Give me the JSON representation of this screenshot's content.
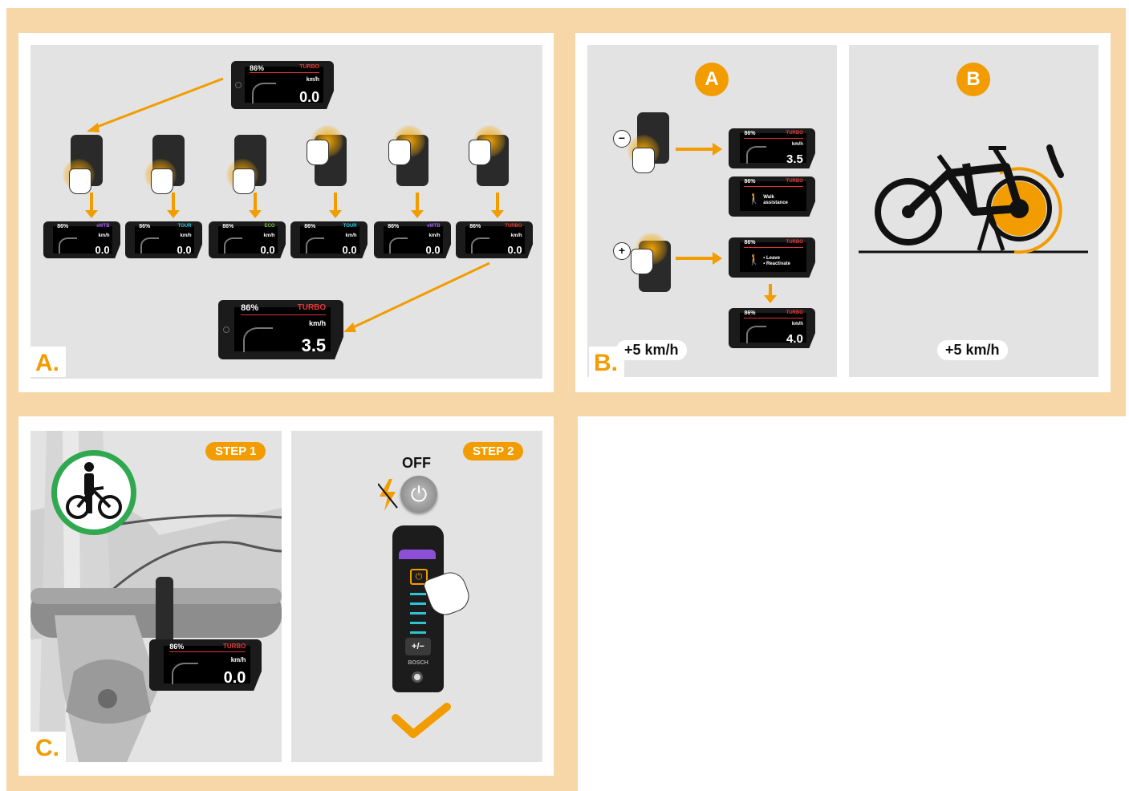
{
  "section_labels": {
    "a": "A.",
    "b": "B.",
    "c": "C."
  },
  "main_display": {
    "battery": "86%",
    "mode": "TURBO",
    "unit": "km/h",
    "speed": "0.0"
  },
  "mode_displays": [
    {
      "battery": "86%",
      "mode": "eMTB",
      "unit": "km/h",
      "speed": "0.0",
      "color": "#9b5de5"
    },
    {
      "battery": "86%",
      "mode": "TOUR",
      "unit": "km/h",
      "speed": "0.0",
      "color": "#2ec4d6"
    },
    {
      "battery": "86%",
      "mode": "ECO",
      "unit": "km/h",
      "speed": "0.0",
      "color": "#7cc243"
    },
    {
      "battery": "86%",
      "mode": "TOUR",
      "unit": "km/h",
      "speed": "0.0",
      "color": "#2ec4d6"
    },
    {
      "battery": "86%",
      "mode": "eMTB",
      "unit": "km/h",
      "speed": "0.0",
      "color": "#9b5de5"
    },
    {
      "battery": "86%",
      "mode": "TURBO",
      "unit": "km/h",
      "speed": "0.0",
      "color": "#e53935"
    }
  ],
  "result_display": {
    "battery": "86%",
    "mode": "TURBO",
    "unit": "km/h",
    "speed": "3.5"
  },
  "panel_b": {
    "badge_a": "A",
    "badge_b": "B",
    "minus_symbol": "−",
    "plus_symbol": "+",
    "display_1": {
      "battery": "86%",
      "mode": "TURBO",
      "unit": "km/h",
      "speed": "3.5"
    },
    "display_2": {
      "battery": "86%",
      "mode": "TURBO",
      "text": "Walk\nassistance"
    },
    "display_3": {
      "battery": "86%",
      "mode": "TURBO",
      "text": "• Leave\n• Reactivate"
    },
    "display_4": {
      "battery": "86%",
      "mode": "TURBO",
      "unit": "km/h",
      "speed": "4.0"
    },
    "pill_a": "+5 km/h",
    "pill_b": "+5 km/h"
  },
  "panel_c": {
    "step1": "STEP 1",
    "step2": "STEP 2",
    "off_label": "OFF",
    "display": {
      "battery": "86%",
      "mode": "TURBO",
      "unit": "km/h",
      "speed": "0.0"
    },
    "controller_plusminus": "+/−",
    "brand": "BOSCH"
  },
  "colors": {
    "accent": "#f29c00",
    "frame": "#f7d6a8",
    "panel": "#e3e3e3",
    "turbo": "#e53935",
    "success": "#2fa84f"
  }
}
